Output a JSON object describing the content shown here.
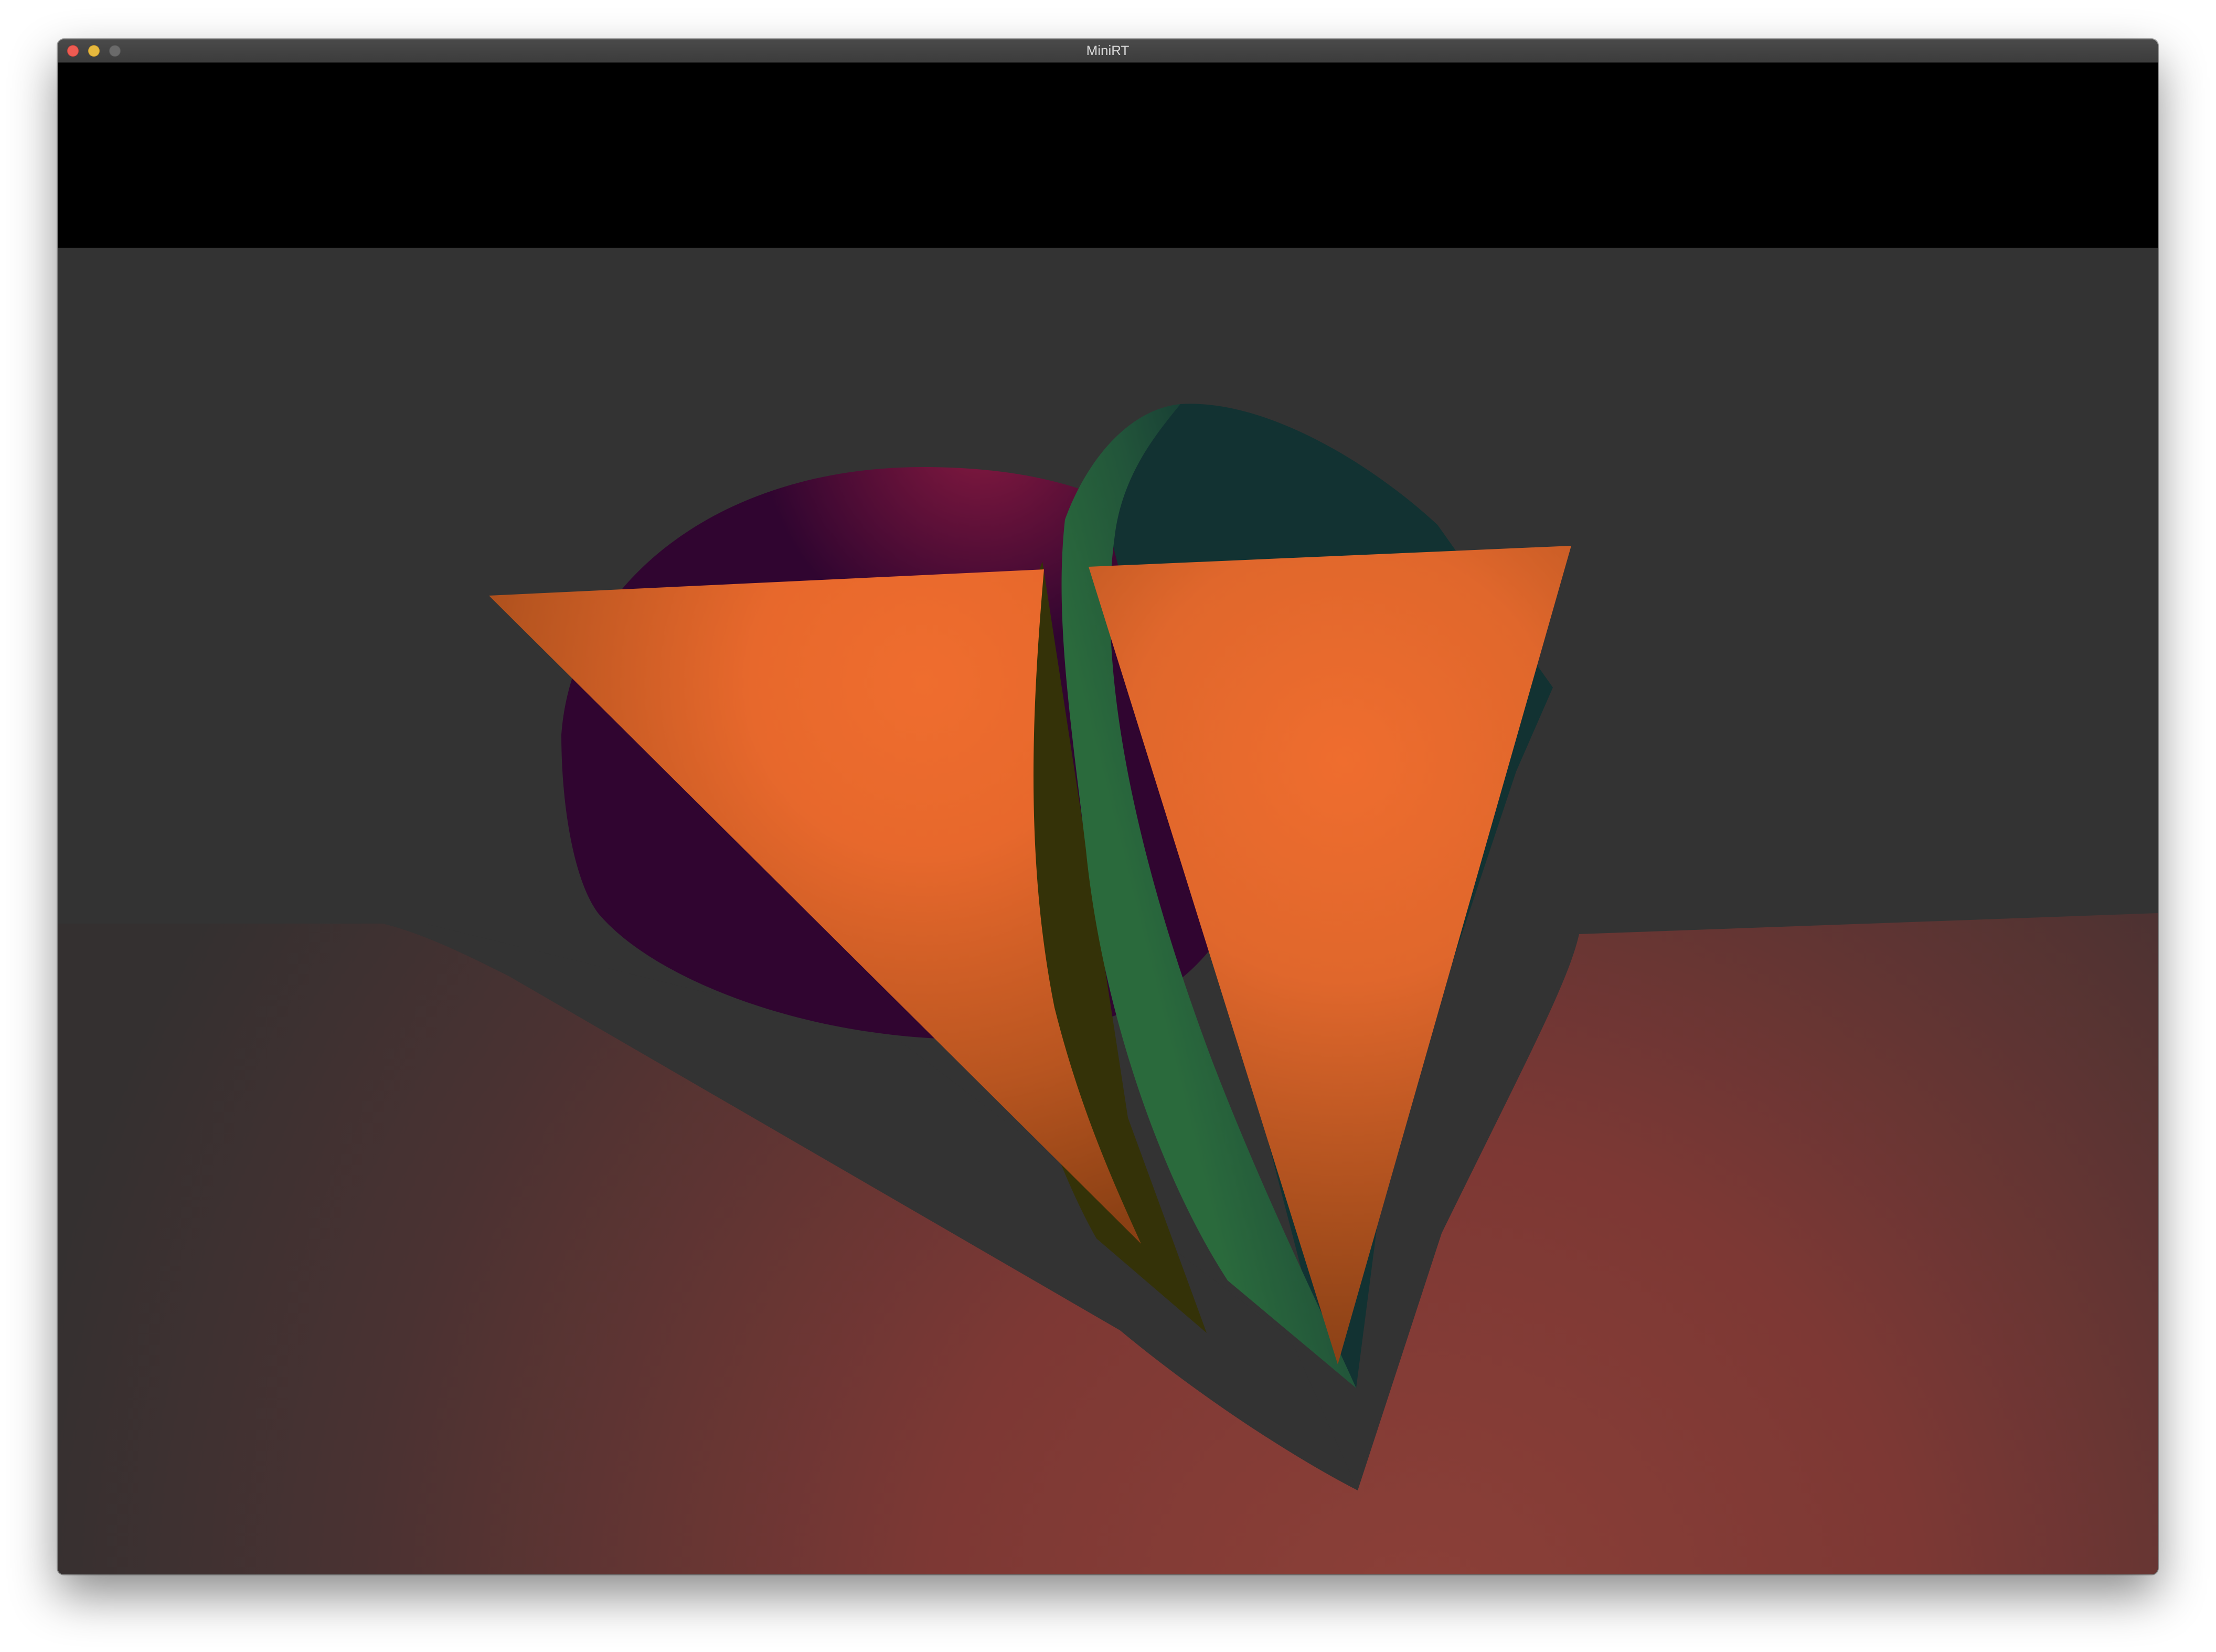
{
  "window": {
    "title": "MiniRT"
  },
  "titlebar": {
    "close_icon": "close-icon",
    "minimize_icon": "minimize-icon",
    "zoom_icon": "zoom-icon"
  },
  "colors": {
    "traffic_close": "#ee5b52",
    "traffic_minimize": "#e7b93e",
    "traffic_zoom": "#6a6a6a",
    "background_band": "#000000",
    "backdrop": "#333333",
    "floor_lit": "#8c4038",
    "sphere": "#300530",
    "sphere_highlight": "#861a40",
    "cone_orange": "#ed6c2e",
    "cone_green_light": "#2a6a3c",
    "cone_green_dark": "#123232",
    "cone_olive": "#343208"
  }
}
